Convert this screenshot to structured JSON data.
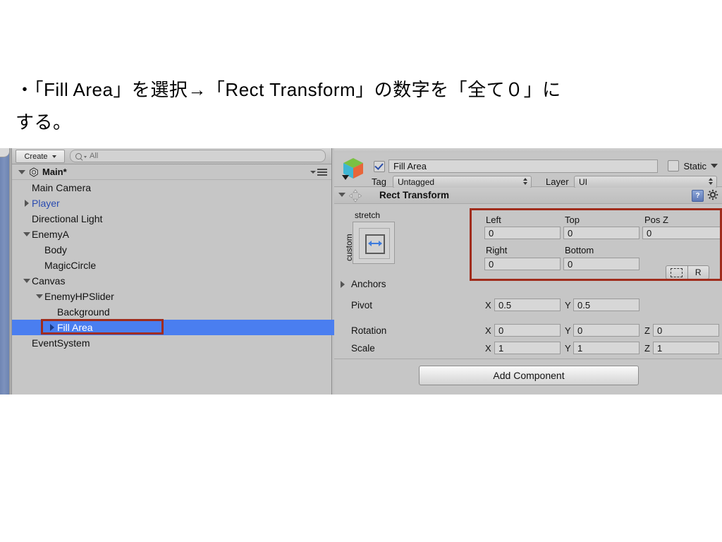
{
  "caption": {
    "line1_prefix": "・",
    "line1": "「Fill Area」を選択→「Rect Transform」の数字を「全て０」に",
    "line2": "する。"
  },
  "hierarchy": {
    "toolbar": {
      "create_label": "Create",
      "search_placeholder": "All",
      "search_value": "All"
    },
    "scene_name": "Main*",
    "items": [
      {
        "label": "Main Camera",
        "indent": 1,
        "arrow": "none",
        "style": "normal",
        "selected": false
      },
      {
        "label": "Player",
        "indent": 1,
        "arrow": "closed",
        "style": "prefab",
        "selected": false
      },
      {
        "label": "Directional Light",
        "indent": 1,
        "arrow": "none",
        "style": "normal",
        "selected": false
      },
      {
        "label": "EnemyA",
        "indent": 1,
        "arrow": "open",
        "style": "normal",
        "selected": false
      },
      {
        "label": "Body",
        "indent": 2,
        "arrow": "none",
        "style": "normal",
        "selected": false
      },
      {
        "label": "MagicCircle",
        "indent": 2,
        "arrow": "none",
        "style": "normal",
        "selected": false
      },
      {
        "label": "Canvas",
        "indent": 1,
        "arrow": "open",
        "style": "normal",
        "selected": false
      },
      {
        "label": "EnemyHPSlider",
        "indent": 2,
        "arrow": "open",
        "style": "normal",
        "selected": false
      },
      {
        "label": "Background",
        "indent": 3,
        "arrow": "none",
        "style": "normal",
        "selected": false
      },
      {
        "label": "Fill Area",
        "indent": 3,
        "arrow": "closed",
        "style": "normal",
        "selected": true
      },
      {
        "label": "EventSystem",
        "indent": 1,
        "arrow": "none",
        "style": "normal",
        "selected": false
      }
    ]
  },
  "inspector": {
    "object_name": "Fill Area",
    "object_enabled": true,
    "static_label": "Static",
    "static_checked": false,
    "tag_label": "Tag",
    "tag_value": "Untagged",
    "layer_label": "Layer",
    "layer_value": "UI",
    "component": {
      "title": "Rect Transform",
      "help_glyph": "?",
      "anchor_preset": "stretch",
      "anchor_preset_side": "custom",
      "fields": {
        "left_label": "Left",
        "left_value": "0",
        "top_label": "Top",
        "top_value": "0",
        "posz_label": "Pos Z",
        "posz_value": "0",
        "right_label": "Right",
        "right_value": "0",
        "bottom_label": "Bottom",
        "bottom_value": "0"
      },
      "blueprint_button": "R",
      "anchors_label": "Anchors",
      "pivot_label": "Pivot",
      "pivot_x_axis": "X",
      "pivot_x": "0.5",
      "pivot_y_axis": "Y",
      "pivot_y": "0.5",
      "rotation_label": "Rotation",
      "rotation_x_axis": "X",
      "rotation_x": "0",
      "rotation_y_axis": "Y",
      "rotation_y": "0",
      "rotation_z_axis": "Z",
      "rotation_z": "0",
      "scale_label": "Scale",
      "scale_x_axis": "X",
      "scale_x": "1",
      "scale_y_axis": "Y",
      "scale_y": "1",
      "scale_z_axis": "Z",
      "scale_z": "1"
    },
    "add_component_label": "Add Component"
  },
  "colors": {
    "selection_blue": "#4a7ef0",
    "highlight_red": "#a02c1c",
    "panel_gray": "#c6c6c6",
    "prefab_blue": "#2a4bb0"
  }
}
